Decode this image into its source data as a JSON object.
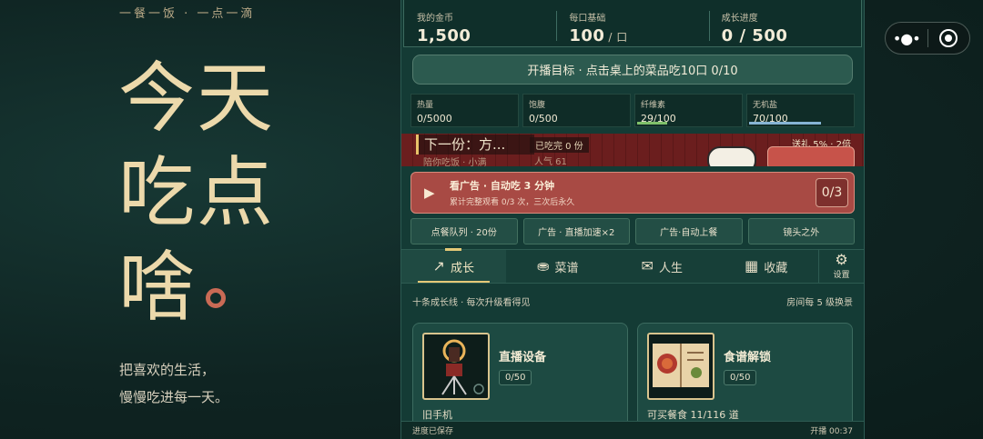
{
  "hero": {
    "tagline": "一餐一饭 · 一点一滴",
    "title_lines": [
      "今天",
      "吃点",
      "啥"
    ],
    "subtitle_lines": [
      "把喜欢的生活，",
      "慢慢吃进每一天。"
    ]
  },
  "stats": [
    {
      "label": "我的金币",
      "value": "1,500",
      "unit": ""
    },
    {
      "label": "每口基础",
      "value": "100",
      "unit": "/ 口"
    },
    {
      "label": "成长进度",
      "value": "0 / 500",
      "unit": ""
    }
  ],
  "goal_label": "开播目标 · 点击桌上的菜品吃10口 0/10",
  "nutrients": [
    {
      "label": "热量",
      "value": "0/5000",
      "fill": 0,
      "color": "#7fb06a"
    },
    {
      "label": "饱腹",
      "value": "0/500",
      "fill": 0,
      "color": "#7fb06a"
    },
    {
      "label": "纤维素",
      "value": "29/100",
      "fill": 0.29,
      "color": "#7fc06a"
    },
    {
      "label": "无机盐",
      "value": "70/100",
      "fill": 0.7,
      "color": "#86b4d4"
    }
  ],
  "stream": {
    "next_label": "下一份：方...",
    "sub_label": "陪你吃饭 · 小满",
    "eaten_label": "已吃完 0 份",
    "popularity": "人气 61",
    "bonus": "送礼 5% · 2倍"
  },
  "ad": {
    "title": "看广告 · 自动吃 3 分钟",
    "subtitle": "累计完整观看 0/3 次，三次后永久",
    "count": "0/3"
  },
  "quick_buttons": [
    "点餐队列 · 20份",
    "广告 · 直播加速×2",
    "广告·自动上餐",
    "镜头之外"
  ],
  "tabs": [
    {
      "label": "成长",
      "icon": "trending-up-icon",
      "glyph": "↗"
    },
    {
      "label": "菜谱",
      "icon": "bowl-icon",
      "glyph": "⛂"
    },
    {
      "label": "人生",
      "icon": "mail-icon",
      "glyph": "✉"
    },
    {
      "label": "收藏",
      "icon": "grid-icon",
      "glyph": "▦"
    }
  ],
  "settings_label": "设置",
  "content": {
    "left_note": "十条成长线 · 每次升级看得见",
    "right_note": "房间每 5 级换景",
    "cards": [
      {
        "title": "直播设备",
        "level": "0/50",
        "footer": "旧手机",
        "icon": "ring-light-icon"
      },
      {
        "title": "食谱解锁",
        "level": "0/50",
        "footer": "可买餐食 11/116 道",
        "icon": "recipe-book-icon"
      }
    ]
  },
  "footer": {
    "left": "进度已保存",
    "right": "开播 00:37"
  },
  "colors": {
    "accent": "#e4c977",
    "hero_text": "#ecd9ab",
    "hero_dot": "#c96a55",
    "panel_bg": "#143b35",
    "ad_bg": "#a84a44"
  }
}
